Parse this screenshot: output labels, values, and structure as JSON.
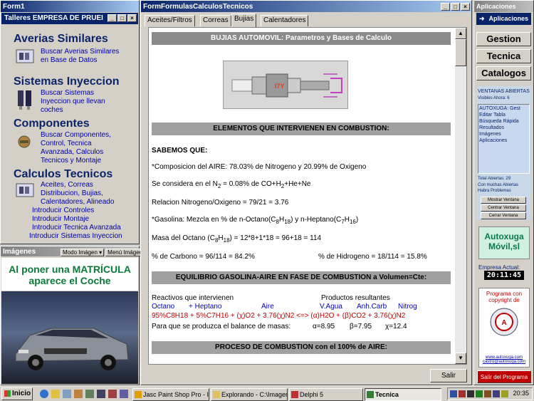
{
  "form1": {
    "title": "Form1",
    "company": "Talleres EMPRESA DE PRUEI",
    "sections": [
      {
        "heading": "Averias Similares",
        "lines": [
          "Buscar Averias Similares",
          "en Base de Datos"
        ]
      },
      {
        "heading": "Sistemas Inyeccion",
        "lines": [
          "Buscar Sistemas",
          "Inyeccion que llevan",
          "coches"
        ]
      },
      {
        "heading": "Componentes",
        "lines": [
          "Buscar Componentes,",
          "Control,  Tecnica",
          "Avanzada,  Calculos",
          "Tecnicos y Montaje"
        ]
      },
      {
        "heading": "Calculos Tecnicos",
        "lines": [
          "Aceites, Correas",
          "Distribucion,  Bujias,",
          "Calentadores, Alineado"
        ]
      }
    ],
    "extra_links": [
      "Introducir Controles",
      "Introducir Montaje",
      "Introducir Tecnica Avanzada",
      "Introducir Sistemas Inyeccion"
    ]
  },
  "imagenes": {
    "title": "Imágenes",
    "mode_button": "Modo Imágen",
    "menu_button": "Menú Imágen",
    "caption_line1": "Al poner una MATRÍCULA",
    "caption_line2": "aparece el Coche"
  },
  "main": {
    "title": "FormFormulasCalculosTecnicos",
    "tabs": [
      "Aceites/Filtros",
      "Correas",
      "Bujias",
      "Calentadores"
    ],
    "active_tab": "Bujias",
    "header": "BUJIAS AUTOMOVIL: Parametros y Bases de Calculo",
    "sect1": "ELEMENTOS QUE INTERVIENEN EN COMBUSTION:",
    "sabemos": "SABEMOS QUE:",
    "line_aire": "*Composicion del AIRE: 78.03% de Nitrogeno y 20.99% de Oxigeno",
    "line_n2a": "Se considera en el N",
    "line_n2b": " = 0.08% de CO+H",
    "line_n2c": "+He+Ne",
    "line_ratio": "Relacion Nitrogeno/Oxigeno = 79/21 = 3.76",
    "line_gas_a": "*Gasolina: Mezcla en % de n-Octano(C",
    "line_gas_b": ") y n-Heptano(C",
    "line_masa_a": "Masa del Octano (C",
    "line_masa_b": ") = 12*8+1*18 = 96+18 = 114",
    "line_pc": "% de Carbono = 96/114 = 84.2%",
    "line_ph": "% de Hidrogeno = 18/114 = 15.8%",
    "sub8": "8",
    "sub18": "18",
    "sub7": "7",
    "sub16": "16",
    "sub2": "2",
    "sect2": "EQUILIBRIO GASOLINA-AIRE EN FASE DE COMBUSTION a Volumen=Cte:",
    "react_label": "Reactivos que intervienen",
    "prod_label": "Productos resultantes",
    "r_octano": "Octano",
    "r_heptano": "+   Heptano",
    "r_aire": "Aire",
    "p_agua": "V.Agua",
    "p_anh": "Anh.Carb",
    "p_nitrog": "Nitrog",
    "equation": "95%C8H18 + 5%C7H16 + (χ)O2 + 3.76(χ)N2 <=> (α)H2O + (β)CO2 + 3.76(χ)N2",
    "balance_label": "Para que se produzca el balance de masas:",
    "alpha": "α=8.95",
    "beta": "β=7.95",
    "chi": "χ=12.4",
    "sect3": "PROCESO DE COMBUSTION con el 100% de AIRE:",
    "salir": "Salir"
  },
  "aplicaciones": {
    "title": "Aplicaciones",
    "top_button": "Aplicaciones",
    "menu": [
      "Gestion",
      "Tecnica",
      "Catalogos"
    ],
    "ventanas_title": "VENTANAS ABIERTAS",
    "visibles": "Visibles Ahora: 6",
    "open_list": [
      "AUTOXUGA: Gest",
      "Editar Tabla",
      "Búsqueda Rápida",
      "Resultados",
      "Imágenes",
      "Aplicaciones"
    ],
    "total": "Total Abiertas: 29",
    "warn1": "Con muchas Abiertas",
    "warn2": "Habra Problemas",
    "btn_mostrar": "Mostrar Ventana",
    "btn_centrar": "Centrar Ventana",
    "btn_cerrar": "Cerrar Ventana",
    "brand1": "Autoxuga",
    "brand2": "Móvil,sl",
    "empresa_actual": "Empresa Actual:",
    "clock": "20:11:45",
    "copyright1": "Programa con",
    "copyright2": "copyright de",
    "url1": "www.autoxuga.com",
    "url2": "castro@autoxuga.com",
    "salir_programa": "Salir del Programa"
  },
  "taskbar": {
    "start": "Inicio",
    "tasks": [
      "Jasc Paint Shop Pro - I...",
      "Explorando - C:\\Imagen...",
      "Delphi 5",
      "Tecnica"
    ],
    "active_task": "Tecnica",
    "time": "20:35"
  },
  "colors": {
    "title_active": "#0a246a",
    "title_gradient": "#a6caf0",
    "heading_blue": "#0a246a",
    "salir_red": "#c00000",
    "brand_green": "#0a7a4a"
  }
}
